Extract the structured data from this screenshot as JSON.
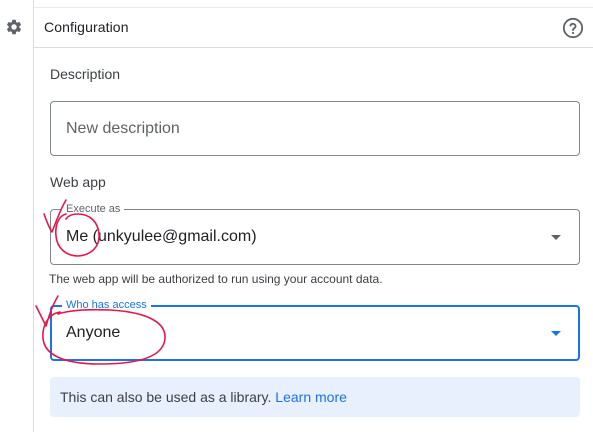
{
  "header": {
    "title": "Configuration"
  },
  "description": {
    "label": "Description",
    "placeholder": "New description"
  },
  "web_app": {
    "label": "Web app",
    "execute_as": {
      "label": "Execute as",
      "value": "Me (unkyulee@gmail.com)"
    },
    "helper_text": "The web app will be authorized to run using your account data.",
    "who_has_access": {
      "label": "Who has access",
      "value": "Anyone"
    }
  },
  "info": {
    "text": "This can also be used as a library.",
    "link": "Learn more"
  },
  "icons": {
    "rail": "gear-icon",
    "help": "help-icon",
    "select_caret": "caret-down-icon"
  },
  "colors": {
    "accent": "#1a73e8",
    "info_background": "#e8f0fe",
    "annotation": "#e8174a"
  }
}
